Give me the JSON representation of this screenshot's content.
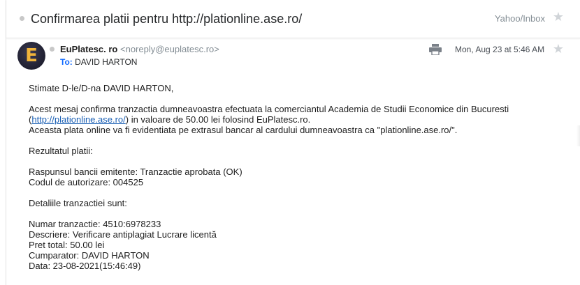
{
  "subject_row": {
    "subject": "Confirmarea platii pentru http://plationline.ase.ro/",
    "folder": "Yahoo/Inbox"
  },
  "message": {
    "avatar_letter": "E",
    "sender_name": "EuPlatesc. ro",
    "sender_email": "<noreply@euplatesc.ro>",
    "to_label": "To:",
    "to_value": "DAVID HARTON",
    "date": "Mon, Aug 23 at 5:46 AM"
  },
  "body": {
    "greeting": "Stimate D-le/D-na DAVID HARTON,",
    "line1": "Acest mesaj confirma tranzactia dumneavoastra efectuata la comerciantul Academia de Studii Economice din Bucuresti",
    "line2_open": "(",
    "line2_link": "http://plationline.ase.ro/",
    "line2_rest": ") in valoare de 50.00 lei  folosind EuPlatesc.ro.",
    "line3": "Aceasta plata online va fi evidentiata pe extrasul bancar al cardului dumneavoastra ca \"plationline.ase.ro/\".",
    "result_heading": "Rezultatul platii:",
    "bank_response": "Raspunsul bancii emitente: Tranzactie aprobata (OK)",
    "auth_code": "Codul de autorizare: 004525",
    "details_heading": "Detaliile tranzactiei sunt:",
    "transaction_number": "Numar tranzactie: 4510:6978233",
    "description": "Descriere: Verificare antiplagiat Lucrare licentă",
    "total_price": "Pret total:  50.00 lei",
    "buyer": "Cumparator:  DAVID HARTON",
    "date_line": "Data: 23-08-2021(15:46:49)"
  },
  "icons": {
    "star": "star-icon",
    "print": "print-icon"
  },
  "colors": {
    "link": "#1a5fb4",
    "to_label": "#0f69ff",
    "avatar_bg": "#1f1f30",
    "avatar_letter": "#f1b43a"
  }
}
